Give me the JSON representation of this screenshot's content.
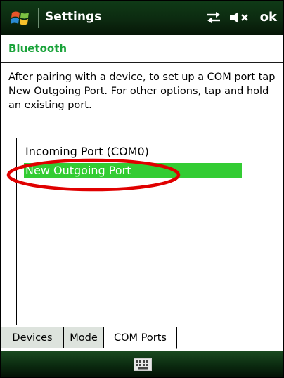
{
  "titlebar": {
    "title": "Settings",
    "ok_label": "ok",
    "icons": [
      "windows-start-icon",
      "connectivity-icon",
      "speaker-muted-icon"
    ]
  },
  "header": {
    "title": "Bluetooth"
  },
  "description": "After pairing with a device, to set up a COM port tap New Outgoing Port. For other options, tap and hold an existing port.",
  "ports": [
    {
      "label": "Incoming Port (COM0)",
      "selected": false
    },
    {
      "label": "New Outgoing Port",
      "selected": true
    }
  ],
  "tabs": [
    {
      "label": "Devices",
      "active": false
    },
    {
      "label": "Mode",
      "active": false
    },
    {
      "label": "COM Ports",
      "active": true
    }
  ],
  "bottombar": {
    "icon": "keyboard-icon"
  },
  "colors": {
    "titlebar_bg": "#0c2a10",
    "header_text": "#1aa33a",
    "selection": "#33cc33",
    "annotation": "#e00000"
  }
}
